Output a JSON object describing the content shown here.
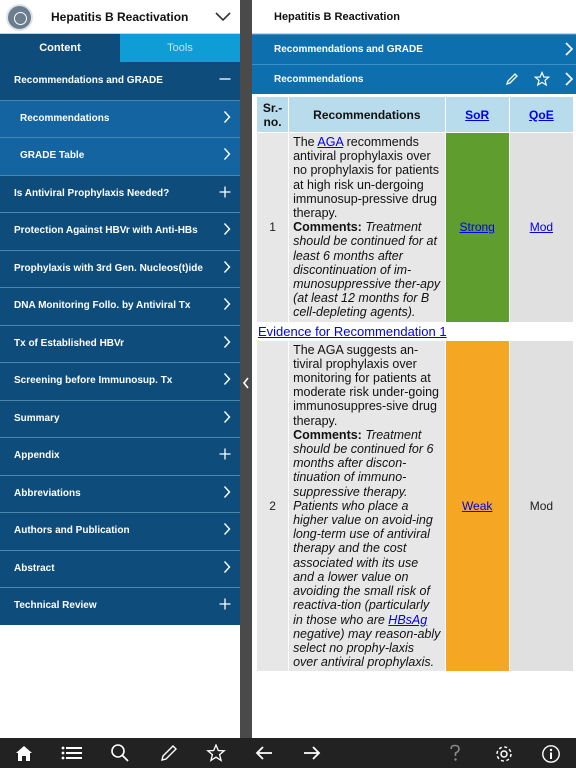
{
  "left": {
    "title": "Hepatitis B Reactivation",
    "tabs": {
      "content": "Content",
      "tools": "Tools"
    },
    "menu": [
      {
        "label": "Recommendations and GRADE",
        "control": "minus",
        "sub": false
      },
      {
        "label": "Recommendations",
        "control": "chevron",
        "sub": true
      },
      {
        "label": "GRADE Table",
        "control": "chevron",
        "sub": true
      },
      {
        "label": "Is Antiviral Prophylaxis Needed?",
        "control": "plus",
        "sub": false
      },
      {
        "label": "Protection Against HBVr with Anti-HBs",
        "control": "chevron",
        "sub": false
      },
      {
        "label": "Prophylaxis with 3rd Gen. Nucleos(t)ide",
        "control": "chevron",
        "sub": false
      },
      {
        "label": "DNA Monitoring Follo. by Antiviral Tx",
        "control": "chevron",
        "sub": false
      },
      {
        "label": "Tx of Established HBVr",
        "control": "chevron",
        "sub": false
      },
      {
        "label": "Screening before Immunosup. Tx",
        "control": "chevron",
        "sub": false
      },
      {
        "label": "Summary",
        "control": "chevron",
        "sub": false
      },
      {
        "label": "Appendix",
        "control": "plus",
        "sub": false
      },
      {
        "label": "Abbreviations",
        "control": "chevron",
        "sub": false
      },
      {
        "label": "Authors and Publication",
        "control": "chevron",
        "sub": false
      },
      {
        "label": "Abstract",
        "control": "chevron",
        "sub": false
      },
      {
        "label": "Technical Review",
        "control": "plus",
        "sub": false
      }
    ]
  },
  "right": {
    "title": "Hepatitis B Reactivation",
    "section_bar": "Recommendations and GRADE",
    "subsection_bar": "Recommendations",
    "table": {
      "headers": {
        "sr": "Sr.-no.",
        "rec": "Recommendations",
        "sor": "SoR",
        "qoe": "QoE"
      },
      "rows": [
        {
          "sr": "1",
          "rec_pre": "The ",
          "rec_link": "AGA",
          "rec_post": " recommends antiviral prophylaxis over no prophylaxis for patients at high risk un-dergoing immunosup-pressive drug therapy.",
          "comments_label": "Comments:",
          "comments_pre": " Treatment should be continued for at least 6 months after discontinuation of im-munosuppressive ther-apy (at least 12 months for B cell-depleting agents).",
          "comments_link": "",
          "comments_post": "",
          "sor": "Strong",
          "qoe": "Mod",
          "qoe_link": true
        },
        {
          "sr": "2",
          "rec_pre": "The AGA suggests an-tiviral prophylaxis over monitoring for patients at moderate risk under-going immunosuppres-sive drug therapy.",
          "rec_link": "",
          "rec_post": "",
          "comments_label": "Comments:",
          "comments_pre": " Treatment should be continued for 6 months after discon-tinuation of immuno-suppressive therapy. Patients who place a higher value on avoid-ing long-term use of antiviral therapy and the cost associated with its use and a lower value on avoiding the small risk of reactiva-tion (particularly in those who are ",
          "comments_link": "HBsAg",
          "comments_post": " negative) may reason-ably select no prophy-laxis over antiviral prophylaxis.",
          "sor": "Weak",
          "qoe": "Mod",
          "qoe_link": false
        }
      ],
      "evidence_link": "Evidence for Recommendation 1"
    }
  },
  "colors": {
    "nav_dark": "#0e4d7b",
    "nav_sub": "#1364a0",
    "tab_inactive": "#0f9dd6",
    "bar_blue": "#0e6fae",
    "strong_green": "#5e9d2e",
    "weak_orange": "#f5a623",
    "header_blue": "#b8dcec"
  },
  "toolbar_icons": [
    "home-icon",
    "list-icon",
    "search-icon",
    "pencil-icon",
    "star-icon",
    "back-arrow-icon",
    "forward-arrow-icon",
    "help-icon",
    "settings-icon",
    "info-icon"
  ]
}
